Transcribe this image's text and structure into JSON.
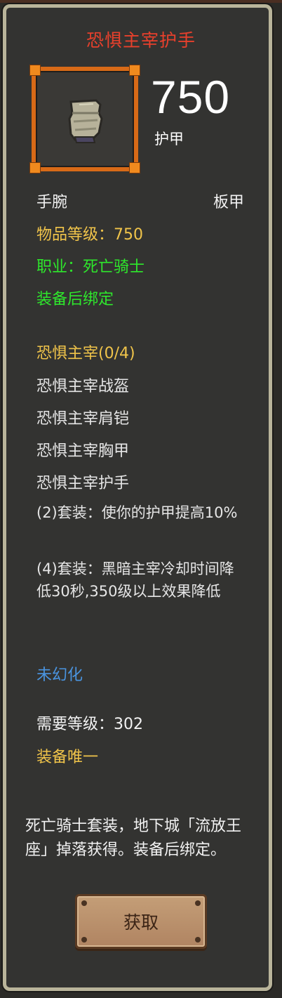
{
  "item": {
    "name": "恐惧主宰护手",
    "armor_value": "750",
    "armor_label": "护甲",
    "slot": "手腕",
    "armor_type": "板甲",
    "item_level": "物品等级：750",
    "class_req": "职业：死亡骑士",
    "bind": "装备后绑定",
    "icon": "gauntlet-icon"
  },
  "set": {
    "name": "恐惧主宰(0/4)",
    "pieces": [
      "恐惧主宰战盔",
      "恐惧主宰肩铠",
      "恐惧主宰胸甲",
      "恐惧主宰护手"
    ],
    "bonus_2": "(2)套装：使你的护甲提高10%",
    "bonus_4": "(4)套装：黑暗主宰冷却时间降低30秒,350级以上效果降低"
  },
  "transmog": "未幻化",
  "required_level": "需要等级：302",
  "unique": "装备唯一",
  "description": "死亡骑士套装，地下城「流放王座」掉落获得。装备后绑定。",
  "acquire_button": "获取",
  "colors": {
    "title_red": "#e8402c",
    "gold": "#f0c44a",
    "green": "#2ee82c",
    "blue": "#4a94e0",
    "frame_orange": "#d86a17"
  }
}
